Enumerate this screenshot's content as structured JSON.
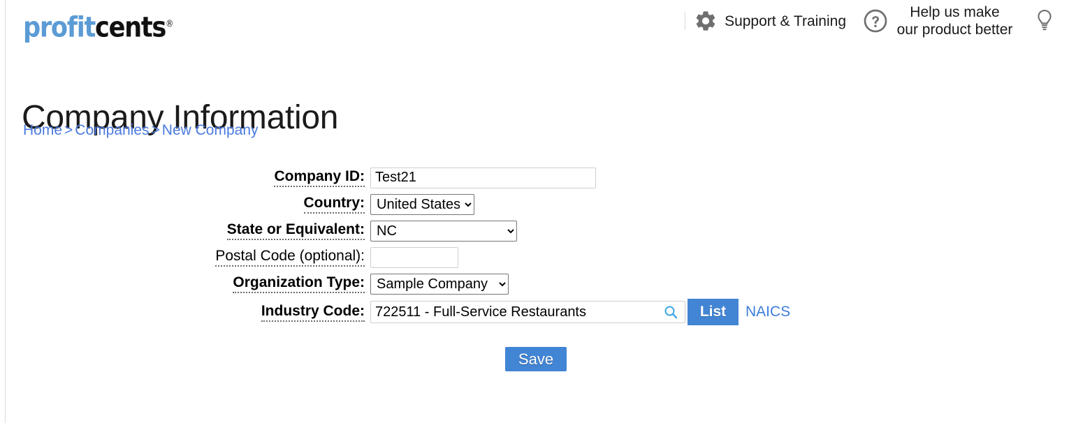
{
  "brand": {
    "logo_part1": "profit",
    "logo_part2": "cents",
    "logo_tm": "®",
    "accent_blue": "#5b9bd5",
    "button_blue": "#4285d4",
    "link_blue": "#3d7ddb",
    "breadcrumb_blue": "#4a7ae0"
  },
  "header": {
    "gear_icon": "gear-icon",
    "support_label": "Support & Training",
    "help_icon": "question-circle-icon",
    "feedback_label": "Help us make our product better",
    "feedback_line1": "Help us make",
    "feedback_line2": "our product better",
    "lightbulb_icon": "lightbulb-icon"
  },
  "page": {
    "title": "Company Information"
  },
  "breadcrumb": {
    "items": [
      {
        "label": "Home"
      },
      {
        "label": "Companies"
      },
      {
        "label": "New Company"
      }
    ],
    "separator": ">"
  },
  "form": {
    "fields": [
      {
        "label": "Company ID:",
        "type": "text",
        "value": "Test21",
        "placeholder": "",
        "bold": true
      },
      {
        "label": "Country:",
        "type": "select",
        "value": "United States",
        "bold": true
      },
      {
        "label": "State or Equivalent:",
        "type": "select",
        "value": "NC",
        "bold": true
      },
      {
        "label": "Postal Code (optional):",
        "type": "text",
        "value": "",
        "placeholder": "",
        "bold": false
      },
      {
        "label": "Organization Type:",
        "type": "select",
        "value": "Sample Company",
        "bold": true
      },
      {
        "label": "Industry Code:",
        "type": "search",
        "value": "722511 - Full-Service Restaurants",
        "placeholder": "",
        "bold": true
      }
    ],
    "company_id": {
      "label": "Company ID:",
      "value": "Test21"
    },
    "country": {
      "label": "Country:",
      "value": "United States"
    },
    "state": {
      "label": "State or Equivalent:",
      "value": "NC"
    },
    "postal": {
      "label": "Postal Code (optional):",
      "value": "",
      "placeholder": ""
    },
    "org_type": {
      "label": "Organization Type:",
      "value": "Sample Company"
    },
    "industry": {
      "label": "Industry Code:",
      "value": "722511 - Full-Service Restaurants",
      "search_icon": "search-icon",
      "list_button": "List",
      "naics_link": "NAICS"
    },
    "save_button": "Save"
  }
}
